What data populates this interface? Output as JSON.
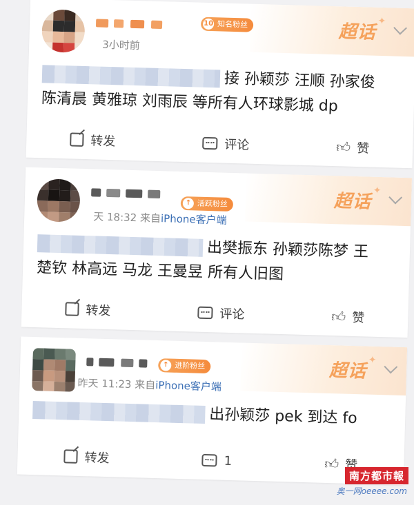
{
  "supertopic_label": "超话",
  "actions": {
    "repost": "转发",
    "comment": "评论",
    "like": "赞"
  },
  "posts": [
    {
      "meta": "3小时前",
      "badge": "知名粉丝",
      "text_1": "接 孙颖莎 汪顺 孙家俊",
      "text_2": "陈清晨 黄雅琼 刘雨辰 等所有人环球影城 dp",
      "comment_label": "评论"
    },
    {
      "meta_time": "天 18:32",
      "meta_from": "来自",
      "meta_client": "iPhone客户端",
      "badge": "活跃粉丝",
      "text_1": "出樊振东 孙颖莎陈梦 王",
      "text_2": "楚钦 林高远 马龙 王曼昱 所有人旧图",
      "comment_label": "评论"
    },
    {
      "meta_time": "昨天 11:23",
      "meta_from": "来自",
      "meta_client": "iPhone客户端",
      "badge": "进阶粉丝",
      "text_1": "出孙颖莎 pek 到达 fo",
      "comment_label": "1"
    }
  ],
  "watermark": {
    "title": "南方都市報",
    "sub": "奥一网oeeee.com"
  }
}
